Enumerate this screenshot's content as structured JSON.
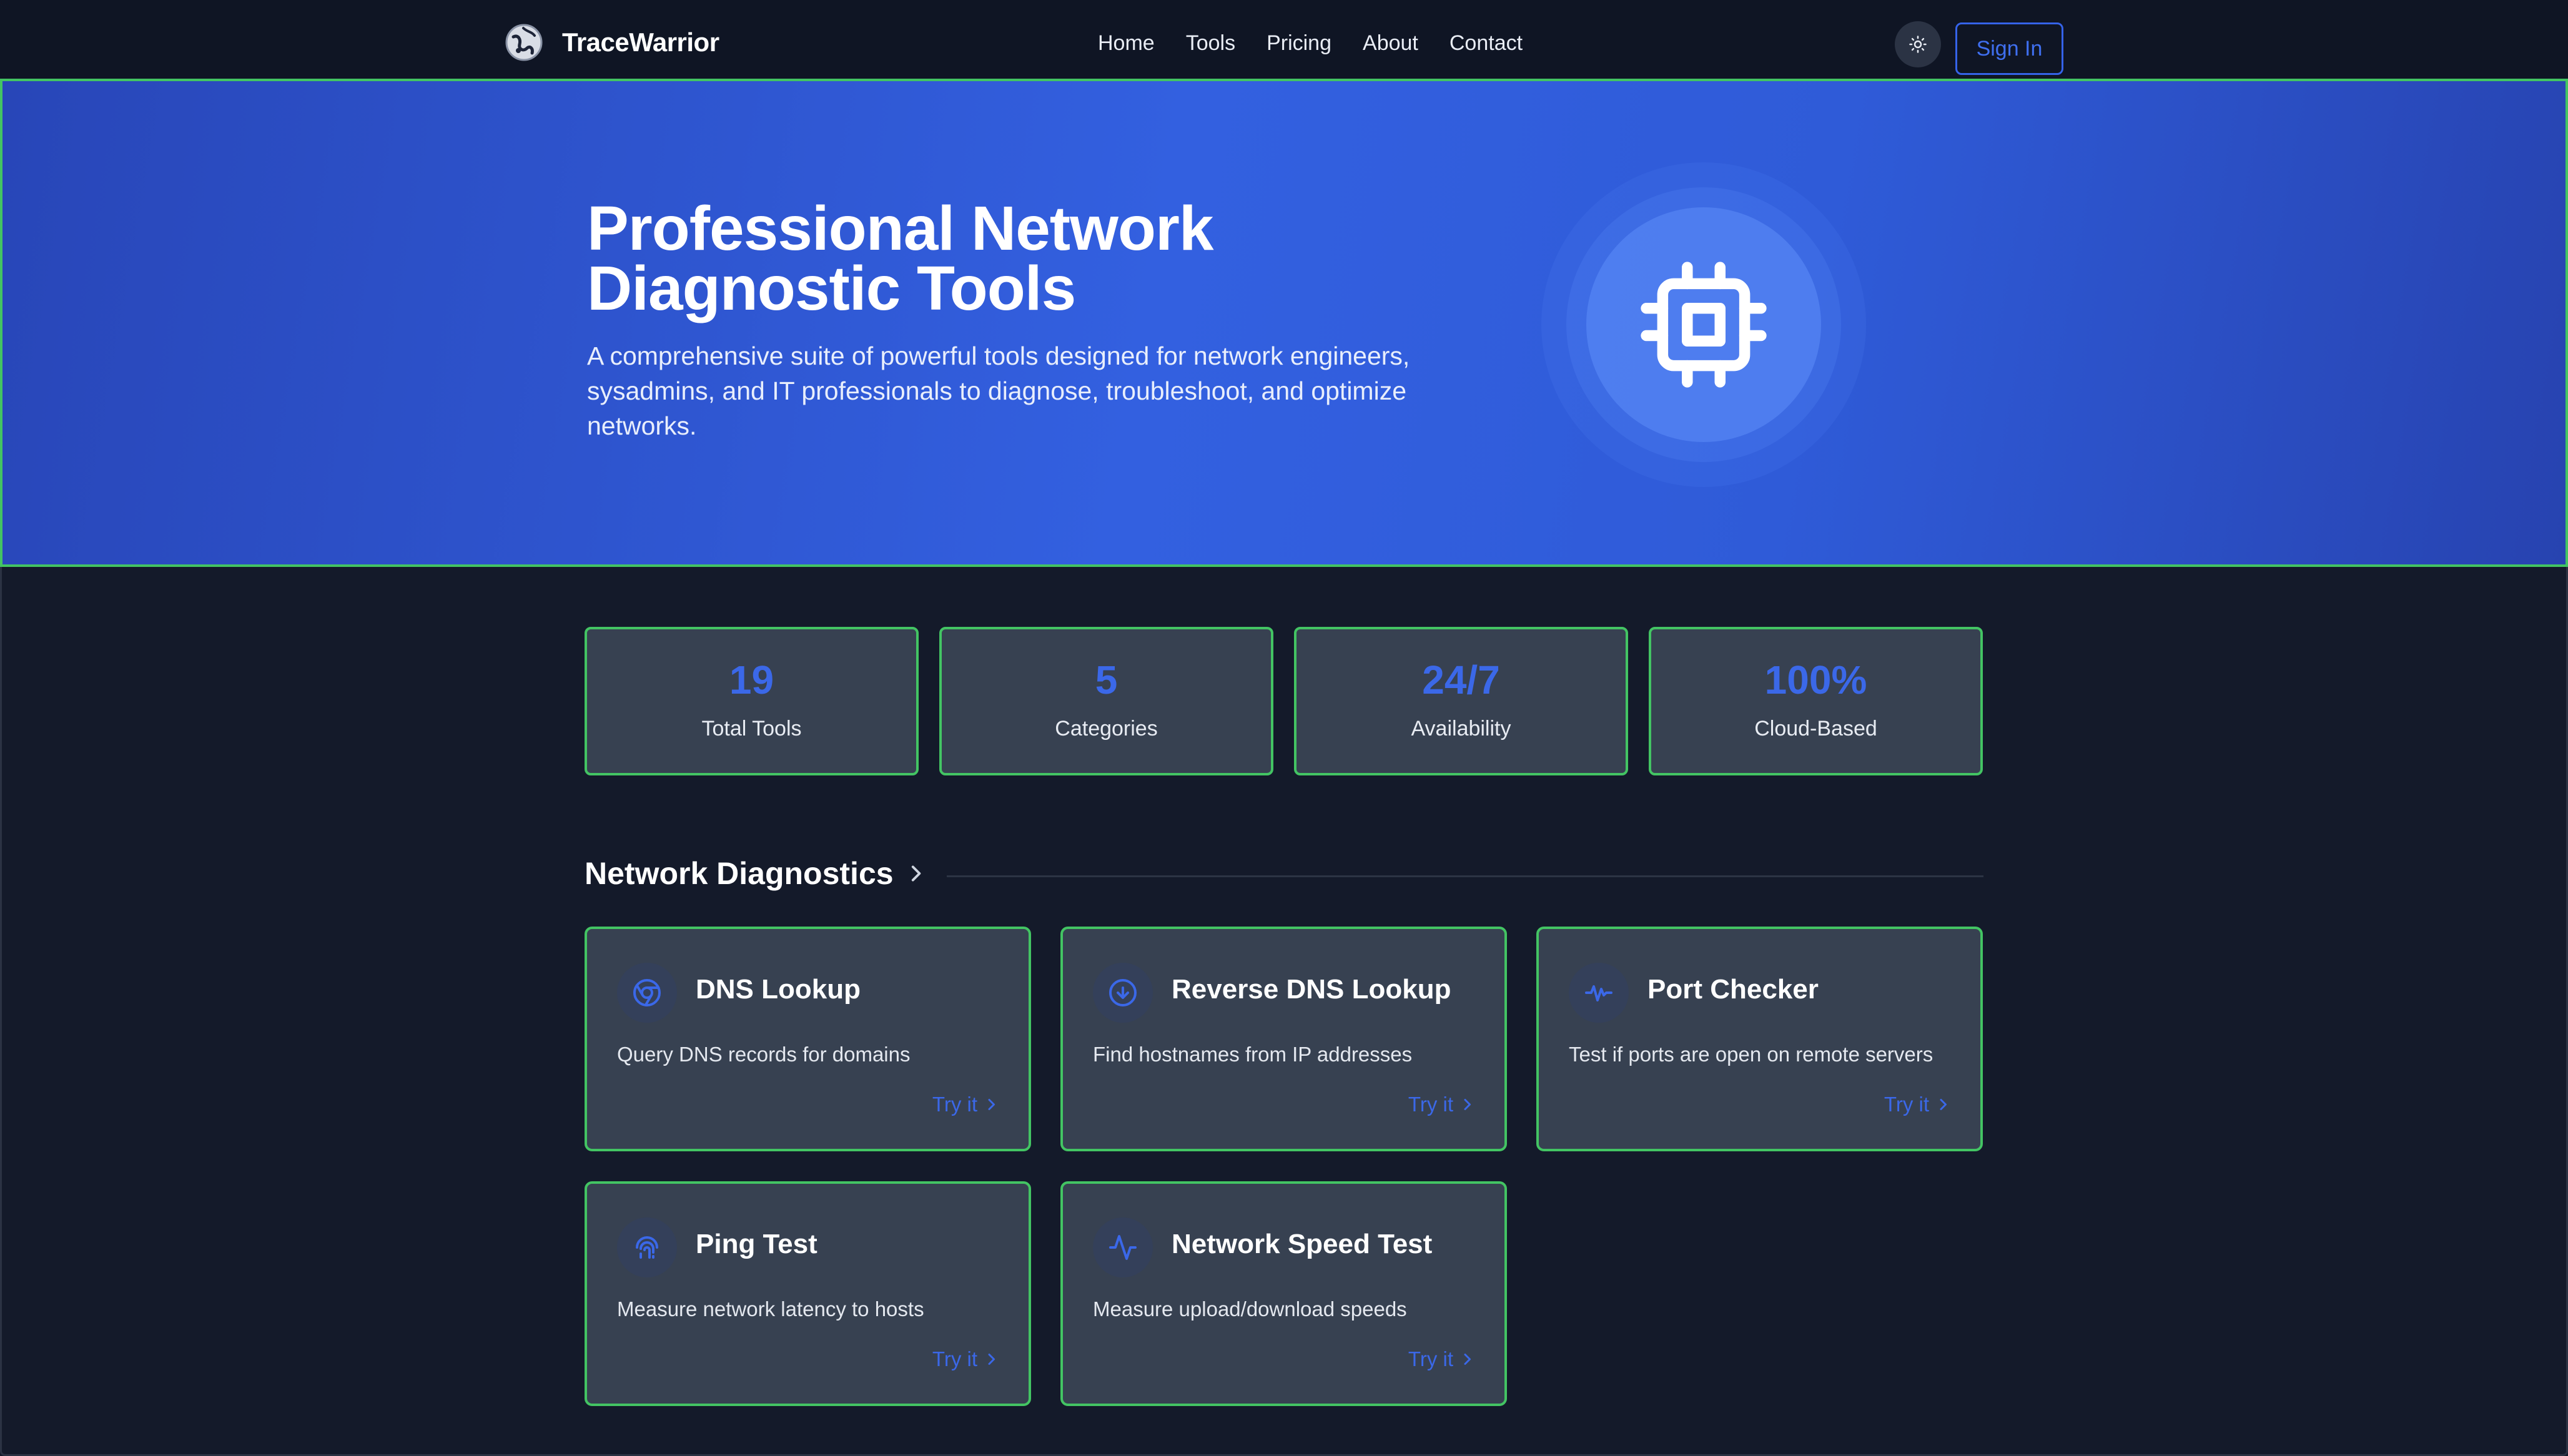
{
  "nav": {
    "brand": "TraceWarrior",
    "links": [
      "Home",
      "Tools",
      "Pricing",
      "About",
      "Contact"
    ],
    "sign_in": "Sign In"
  },
  "hero": {
    "title_line1": "Professional Network",
    "title_line2": "Diagnostic Tools",
    "description": "A comprehensive suite of powerful tools designed for network engineers, sysadmins, and IT professionals to diagnose, troubleshoot, and optimize networks.",
    "icon": "cpu-chip-icon"
  },
  "stats": [
    {
      "value": "19",
      "label": "Total Tools"
    },
    {
      "value": "5",
      "label": "Categories"
    },
    {
      "value": "24/7",
      "label": "Availability"
    },
    {
      "value": "100%",
      "label": "Cloud-Based"
    }
  ],
  "section": {
    "title": "Network Diagnostics"
  },
  "tools": [
    {
      "title": "DNS Lookup",
      "description": "Query DNS records for domains",
      "cta": "Try it",
      "icon": "chrome-icon"
    },
    {
      "title": "Reverse DNS Lookup",
      "description": "Find hostnames from IP addresses",
      "cta": "Try it",
      "icon": "arrow-down-circle-icon"
    },
    {
      "title": "Port Checker",
      "description": "Test if ports are open on remote servers",
      "cta": "Try it",
      "icon": "signal-icon"
    },
    {
      "title": "Ping Test",
      "description": "Measure network latency to hosts",
      "cta": "Try it",
      "icon": "fingerprint-icon"
    },
    {
      "title": "Network Speed Test",
      "description": "Measure upload/download speeds",
      "cta": "Try it",
      "icon": "activity-icon"
    }
  ],
  "colors": {
    "accent": "#3b68e8",
    "border_highlight": "#43c463",
    "card_bg": "#374151",
    "page_bg": "#141a2a"
  }
}
